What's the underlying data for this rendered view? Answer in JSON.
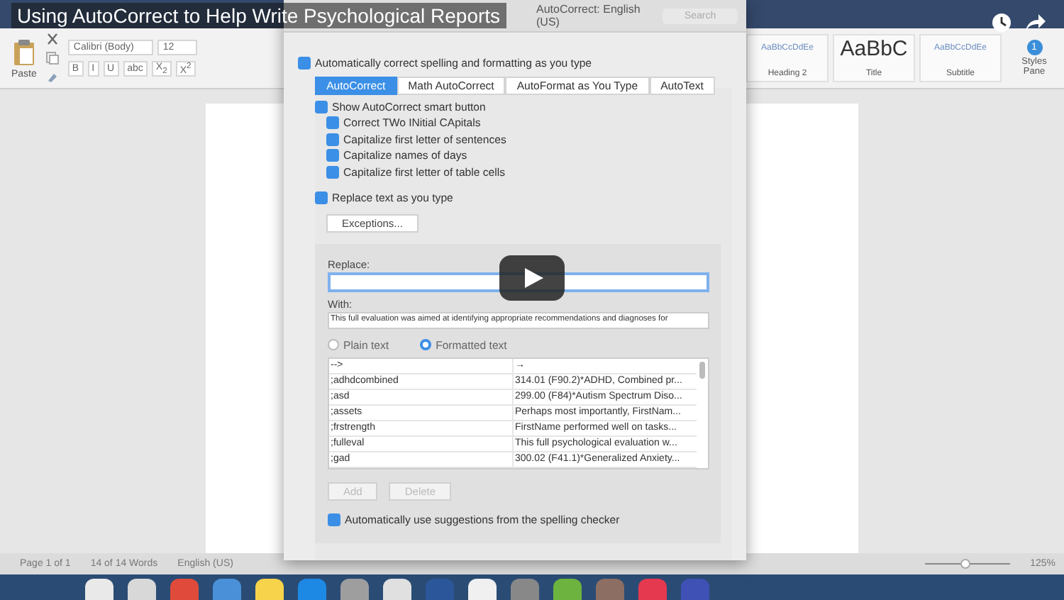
{
  "video": {
    "title": "Using AutoCorrect to Help Write Psychological Reports"
  },
  "ribbon": {
    "paste_label": "Paste",
    "font": "Calibri (Body)",
    "size": "12",
    "format_buttons": [
      "B",
      "I",
      "U",
      "abc",
      "X$_{2}$",
      "X$^{2}$"
    ],
    "styles": [
      {
        "preview": "AaBbCcDdEe",
        "name": "Heading 2",
        "kind": "small"
      },
      {
        "preview": "AaBbC",
        "name": "Title",
        "kind": "large"
      },
      {
        "preview": "AaBbCcDdEe",
        "name": "Subtitle",
        "kind": "small"
      }
    ],
    "styles_pane": "Styles Pane",
    "styles_badge": "1"
  },
  "dialog": {
    "title": "AutoCorrect: English (US)",
    "search_placeholder": "Search",
    "main_option": {
      "label": "Automatically correct spelling and formatting as you type",
      "checked": true
    },
    "tabs": [
      {
        "label": "AutoCorrect",
        "selected": true
      },
      {
        "label": "Math AutoCorrect",
        "selected": false
      },
      {
        "label": "AutoFormat as You Type",
        "selected": false
      },
      {
        "label": "AutoText",
        "selected": false
      }
    ],
    "options": [
      {
        "label": "Show AutoCorrect smart button",
        "checked": true,
        "children": [
          {
            "label": "Correct TWo INitial CApitals",
            "checked": true
          },
          {
            "label": "Capitalize first letter of sentences",
            "checked": true
          },
          {
            "label": "Capitalize names of days",
            "checked": true
          },
          {
            "label": "Capitalize first letter of table cells",
            "checked": true
          }
        ]
      }
    ],
    "replace_option": {
      "label": "Replace text as you type",
      "checked": true
    },
    "exceptions_button": "Exceptions...",
    "replace": {
      "label": "Replace:"
    },
    "with": {
      "label": "With:",
      "value": "This full evaluation was aimed at identifying appropriate recommendations and diagnoses for"
    },
    "format_radios": [
      {
        "label": "Plain text",
        "selected": false
      },
      {
        "label": "Formatted text",
        "selected": true
      }
    ],
    "entries": [
      {
        "replace": "-->",
        "with": "→"
      },
      {
        "replace": ";adhdcombined",
        "with": "314.01 (F90.2)*ADHD, Combined pr..."
      },
      {
        "replace": ";asd",
        "with": "299.00 (F84)*Autism Spectrum Diso..."
      },
      {
        "replace": ";assets",
        "with": "Perhaps most importantly, FirstNam..."
      },
      {
        "replace": ";frstrength",
        "with": "FirstName performed well on tasks..."
      },
      {
        "replace": ";fulleval",
        "with": "This full psychological evaluation w..."
      },
      {
        "replace": ";gad",
        "with": "300.02 (F41.1)*Generalized Anxiety..."
      }
    ],
    "buttons": [
      {
        "label": "Add",
        "disabled": true
      },
      {
        "label": "Delete",
        "disabled": true
      }
    ],
    "spelling_option": {
      "label": "Automatically use suggestions from the spelling checker",
      "checked": true
    }
  },
  "status_bar": {
    "page": "Page 1 of 1",
    "words": "14 of 14 Words",
    "language": "English (US)",
    "zoom": {
      "level": 0.47
    },
    "zoom_text": "125%"
  }
}
